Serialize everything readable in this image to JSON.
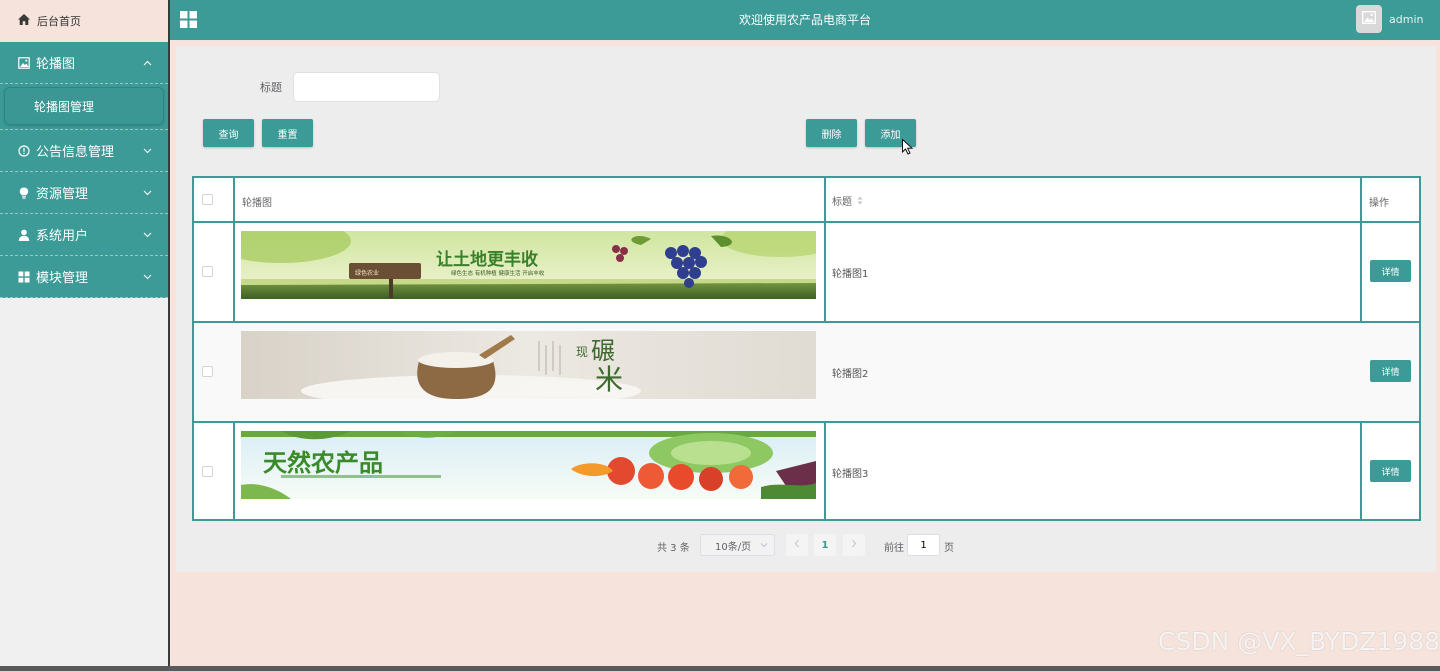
{
  "sidebar": {
    "home_label": "后台首页",
    "groups": [
      {
        "label": "轮播图",
        "icon": "image-icon",
        "expanded": true,
        "children": [
          {
            "label": "轮播图管理"
          }
        ]
      },
      {
        "label": "公告信息管理",
        "icon": "info-circle-icon",
        "expanded": false
      },
      {
        "label": "资源管理",
        "icon": "bulb-icon",
        "expanded": false
      },
      {
        "label": "系统用户",
        "icon": "user-icon",
        "expanded": false
      },
      {
        "label": "模块管理",
        "icon": "grid-icon",
        "expanded": false
      }
    ]
  },
  "header": {
    "title": "欢迎使用农产品电商平台",
    "user": "admin"
  },
  "search": {
    "label": "标题",
    "value": "",
    "placeholder": ""
  },
  "toolbar": {
    "query_label": "查询",
    "reset_label": "重置",
    "delete_label": "删除",
    "add_label": "添加"
  },
  "table": {
    "columns": [
      "轮播图",
      "标题",
      "操作"
    ],
    "rows": [
      {
        "title": "轮播图1",
        "action": "详情"
      },
      {
        "title": "轮播图2",
        "action": "详情"
      },
      {
        "title": "轮播图3",
        "action": "详情"
      }
    ]
  },
  "banners": [
    {
      "headline": "让土地更丰收",
      "sub": "绿色生态  有机种植  健康生活  开启丰收",
      "sign1": "绿色农业",
      "sign2": "健康生活"
    },
    {
      "headline": "碾",
      "headline2": "米",
      "side": "现"
    },
    {
      "headline": "天然农产品"
    }
  ],
  "pagination": {
    "total": "共 3 条",
    "page_size": "10条/页",
    "current": "1",
    "goto_prefix": "前往",
    "goto_value": "1",
    "goto_suffix": "页"
  },
  "watermark": "CSDN @VX_BYDZ1988",
  "colors": {
    "primary": "#3c9a97",
    "page_bg": "#f5e3dc",
    "panel_bg": "#ededed"
  }
}
